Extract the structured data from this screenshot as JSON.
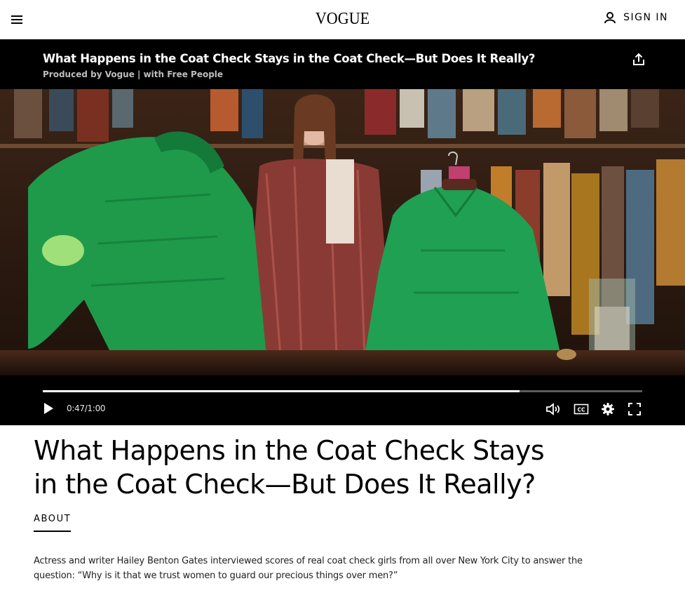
{
  "header": {
    "logo": "VOGUE",
    "sign_in_label": "SIGN IN"
  },
  "video": {
    "title": "What Happens in the Coat Check Stays in the Coat Check—But Does It Really?",
    "subtitle": "Produced by Vogue | with Free People",
    "timecode": "0:47/1:00",
    "progress": 0.795
  },
  "article": {
    "headline_line1": "What Happens in the Coat Check Stays",
    "headline_line2": "in the Coat Check—But Does It Really?",
    "about_label": "ABOUT",
    "description_line1": "Actress and writer Hailey Benton Gates interviewed scores of real coat check girls from all over New York City to answer the",
    "description_line2": "question: “Why is it that we trust women to guard our precious things over men?”"
  },
  "icons": {
    "menu": "hamburger-icon",
    "account": "person-icon",
    "share": "share-icon",
    "play": "play-icon",
    "volume": "volume-icon",
    "captions": "cc-icon",
    "settings": "gear-icon",
    "fullscreen": "fullscreen-icon"
  }
}
